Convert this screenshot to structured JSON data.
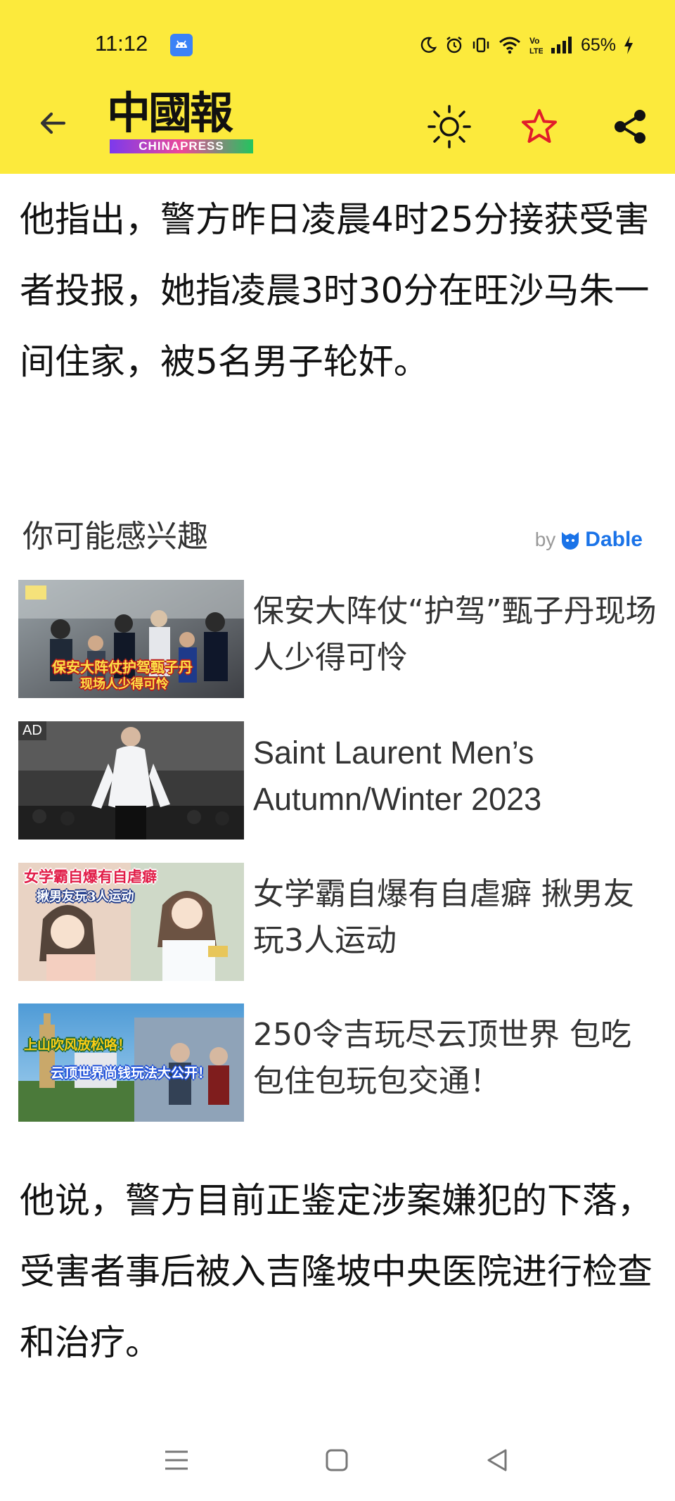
{
  "status_bar": {
    "time": "11:12",
    "battery": "65%"
  },
  "toolbar": {
    "logo_cn": "中國報",
    "logo_en": "CHINAPRESS"
  },
  "article": {
    "paragraph_1": "他指出，警方昨日凌晨4时25分接获受害者投报，她指凌晨3时30分在旺沙马朱一间住家，被5名男子轮奸。",
    "paragraph_2": "他说，警方目前正鉴定涉案嫌犯的下落，受害者事后被入吉隆坡中央医院进行检查和治疗。"
  },
  "recommendations": {
    "heading": "你可能感兴趣",
    "provider_by": "by",
    "provider_name": "Dable",
    "items": [
      {
        "title": "保安大阵仗“护驾”甄子丹现场人少得可怜",
        "thumb_caption_1": "保安大阵仗护驾甄子丹",
        "thumb_caption_2": "现场人少得可怜"
      },
      {
        "title": "Saint Laurent Men’s Autumn/Winter 2023",
        "badge": "AD"
      },
      {
        "title": "女学霸自爆有自虐癖 揪男友玩3人运动",
        "thumb_caption_1": "女学霸自爆有自虐癖",
        "thumb_caption_2": "揪男友玩3人运动"
      },
      {
        "title": "250令吉玩尽云顶世界 包吃包住包玩包交通！",
        "thumb_caption_1": "上山吹风放松咯！",
        "thumb_caption_2": "云顶世界尚钱玩法大公开！"
      }
    ]
  },
  "colors": {
    "header_bg": "#fcea3c",
    "star": "#e11d2a",
    "dable_blue": "#1a73e8"
  }
}
